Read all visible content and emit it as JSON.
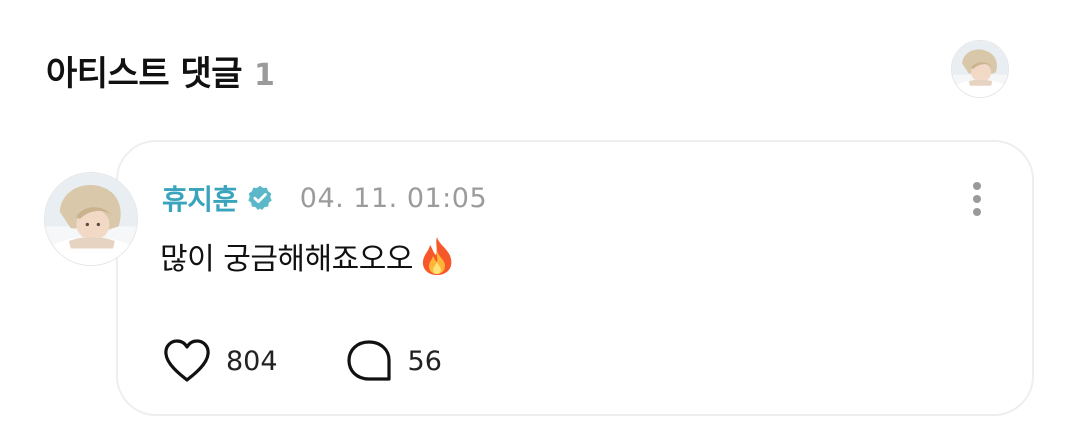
{
  "header": {
    "title": "아티스트 댓글",
    "count": "1",
    "avatar_icon": "user-avatar-photo"
  },
  "comment": {
    "avatar_icon": "artist-avatar-photo",
    "author": "휴지훈",
    "verified_icon": "verified-badge-icon",
    "timestamp": "04. 11. 01:05",
    "text": "많이 궁금해해죠오오",
    "emoji_icon": "fire-emoji",
    "likes": "804",
    "replies": "56"
  },
  "colors": {
    "author": "#3ba4bd",
    "verified": "#5bb8c9",
    "muted": "#9b9b9b",
    "card_border": "#eeeeee"
  }
}
